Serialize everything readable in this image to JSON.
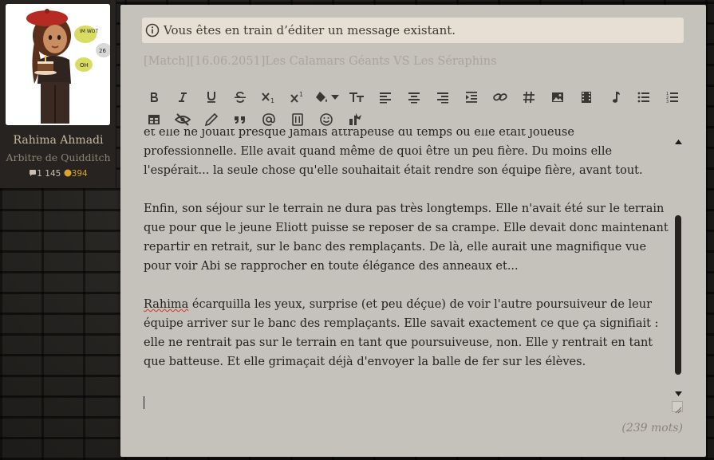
{
  "user": {
    "name": "Rahima Ahmadi",
    "role": "Arbitre de Quidditch",
    "messages": "1 145",
    "coins": "394",
    "avatar_bubbles": [
      "IM WOT",
      "26",
      "OH"
    ]
  },
  "editor": {
    "notice": "Vous êtes en train d’éditer un message existant.",
    "subject": "[Match][16.06.2051]Les Calamars Géants VS Les Séraphins",
    "paragraphs": [
      "et elle ne jouait presque jamais attrapeuse du temps où elle était joueuse professionnelle. Elle avait quand même de quoi être un peu fière. Du moins elle l'espérait... la seule chose qu'elle souhaitait était rendre son équipe fière, avant tout.",
      "Enfin, son séjour sur le terrain ne dura pas très longtemps. Elle n'avait été sur le terrain que pour que le jeune Eliott puisse se reposer de sa crampe. Elle devait donc maintenant repartir en retrait, sur le banc des remplaçants. De là, elle aurait une magnifique vue pour voir Abi se rapprocher en toute élégance des anneaux et...",
      "écarquilla les yeux, surprise (et peu déçue) de voir l'autre poursuiveur de leur équipe arriver sur le banc des remplaçants. Elle savait exactement ce que ça signifiait : elle ne rentrait pas sur le terrain en tant que poursuiveuse, non. Elle y rentrait en tant que batteuse. Et elle grimaçait déjà d'envoyer la balle de fer sur les élèves."
    ],
    "misspelled_word": "Rahima",
    "word_count": "(239 mots)"
  },
  "toolbar": {
    "row1": [
      "bold-icon",
      "italic-icon",
      "underline-icon",
      "strikethrough-icon",
      "subscript-icon",
      "superscript-icon",
      "fill-color-icon",
      "font-size-icon",
      "align-left-icon",
      "align-center-icon",
      "align-right-icon",
      "indent-icon",
      "link-icon",
      "hashtag-icon",
      "image-icon",
      "video-icon",
      "music-icon",
      "bullet-list-icon",
      "numbered-list-icon"
    ],
    "row2": [
      "table-icon",
      "hide-icon",
      "pen-icon",
      "quote-icon",
      "at-icon",
      "code-icon",
      "emoji-icon",
      "spoiler-icon"
    ]
  },
  "colors": {
    "editor_bg": "#c5c1bb",
    "notice_bg": "#e7dfd3",
    "scrollbar": "#27221d",
    "coin": "#d8a531",
    "spellcheck": "#d6332c"
  }
}
